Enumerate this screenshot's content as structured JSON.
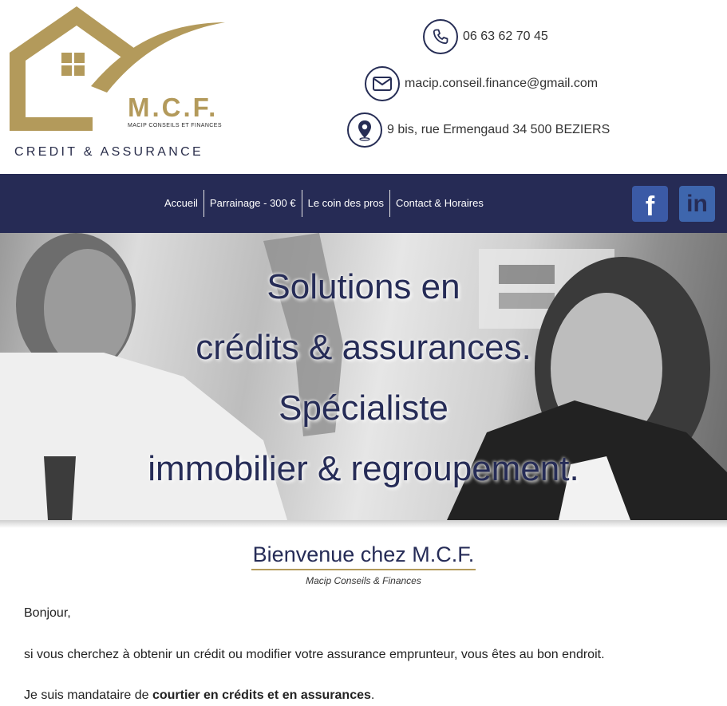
{
  "logo": {
    "brand": "M.C.F.",
    "subtitle": "MACIP CONSEILS ET FINANCES",
    "tagline": "CREDIT & ASSURANCE",
    "gold": "#b39a5b"
  },
  "contact": {
    "phone": "06 63 62 70 45",
    "email": "macip.conseil.finance@gmail.com",
    "address": "9 bis, rue Ermengaud  34 500 BEZIERS",
    "icons": [
      "phone-icon",
      "envelope-icon",
      "map-pin-icon"
    ]
  },
  "nav": {
    "items": [
      {
        "label": "Accueil"
      },
      {
        "label": "Parrainage - 300 €"
      },
      {
        "label": "Le coin des pros"
      },
      {
        "label": "Contact & Horaires"
      }
    ],
    "background": "#262b55"
  },
  "social": {
    "facebook": "f",
    "linkedin": "in"
  },
  "hero": {
    "lines": [
      "Solutions en",
      "crédits & assurances.",
      "Spécialiste",
      "immobilier & regroupement."
    ]
  },
  "welcome": {
    "title": "Bienvenue chez M.C.F.",
    "subtitle": "Macip Conseils & Finances"
  },
  "body": {
    "p1": "Bonjour,",
    "p2": "si vous cherchez à obtenir un crédit ou modifier votre assurance emprunteur, vous êtes au bon endroit.",
    "p3_start": "Je suis mandataire de ",
    "p3_bold": "courtier en crédits et en assurances",
    "p3_end": "."
  }
}
